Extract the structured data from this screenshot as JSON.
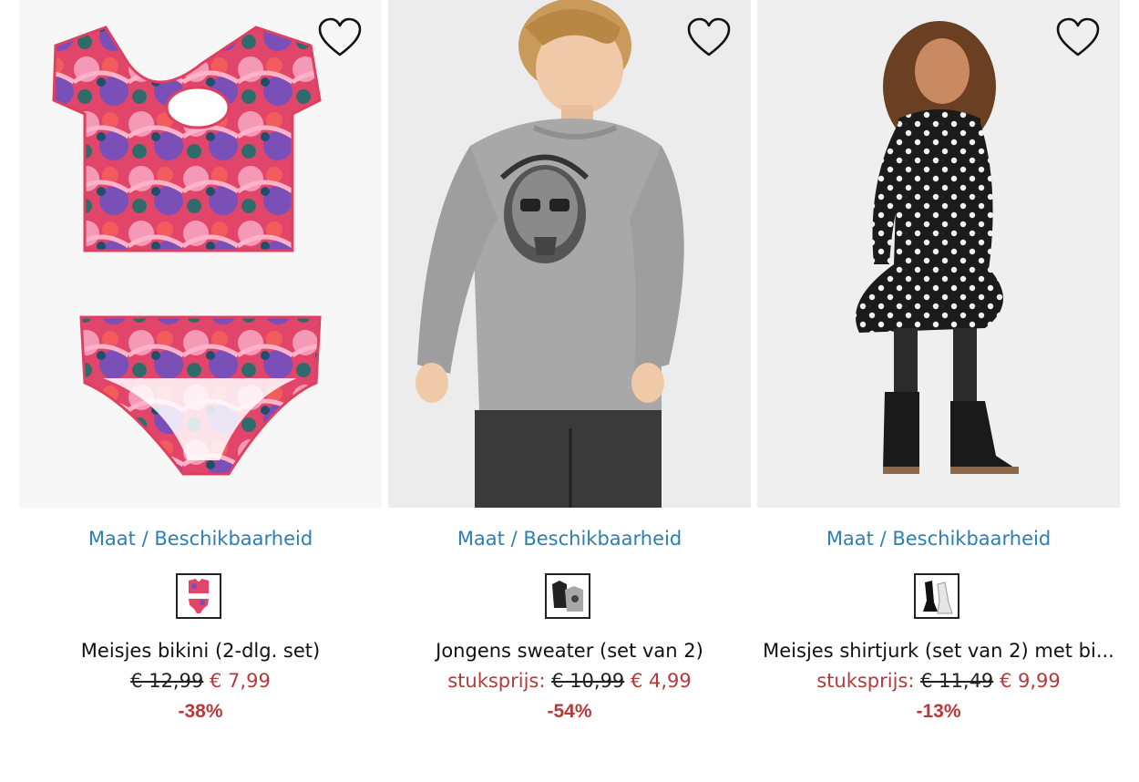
{
  "size_link_label": "Maat / Beschikbaarheid",
  "products": [
    {
      "title": "Meisjes bikini (2-dlg. set)",
      "unit_label": "",
      "old_price": "€ 12,99",
      "new_price": "€ 7,99",
      "discount": "-38%",
      "favorite_icon": "heart-outline-icon"
    },
    {
      "title": "Jongens sweater (set van 2)",
      "unit_label": "stuksprijs:",
      "old_price": "€ 10,99",
      "new_price": "€ 4,99",
      "discount": "-54%",
      "favorite_icon": "heart-outline-icon"
    },
    {
      "title": "Meisjes shirtjurk (set van 2) met bi...",
      "unit_label": "stuksprijs:",
      "old_price": "€ 11,49",
      "new_price": "€ 9,99",
      "discount": "-13%",
      "favorite_icon": "heart-outline-icon"
    }
  ],
  "colors": {
    "link": "#2a7fb5",
    "sale": "#b8383b",
    "text": "#111111"
  }
}
